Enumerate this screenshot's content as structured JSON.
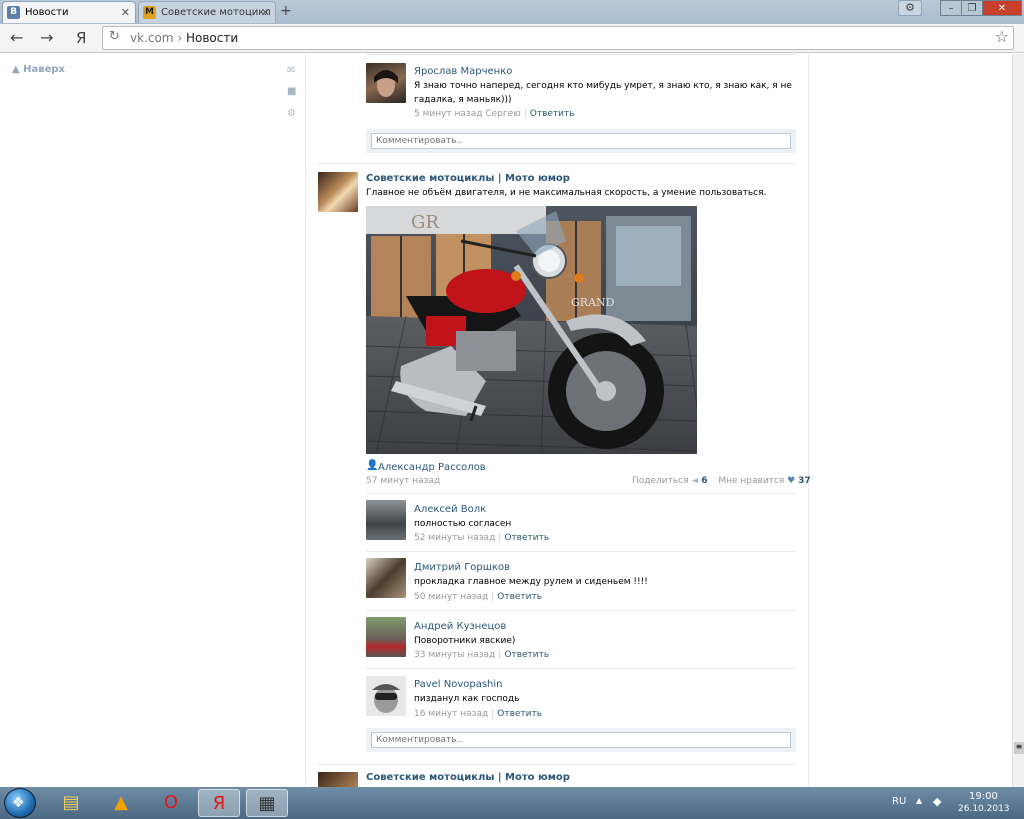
{
  "browser": {
    "tabs": [
      {
        "label": "Новости",
        "favicon": "В"
      },
      {
        "label": "Советские мотоцикл",
        "favicon": "M"
      }
    ],
    "newtab": "+",
    "yandex_btn": "Я",
    "url_domain": "vk.com",
    "url_sep": "›",
    "url_page": "Новости"
  },
  "sidebar": {
    "up_label": "▲ Наверх"
  },
  "top_comment": {
    "author": "Ярослав Марченко",
    "text": "Я знаю точно наперед, сегодня кто мибудь умрет, я знаю кто, я знаю как, я не гадалка, я маньяк)))",
    "time": "5 минут назад Сергею",
    "reply": "Ответить"
  },
  "comment_placeholder": "Комментировать..",
  "post": {
    "group": "Советские мотоциклы | Мото юмор",
    "text": "Главное не объём двигателя, и не максимальная скорость, а умение пользоваться.",
    "author": "Александр Рассолов",
    "time": "57 минут назад",
    "share_label": "Поделиться",
    "share_count": "6",
    "like_label": "Мне нравится",
    "like_count": "37",
    "image_sign_text": "GRAND",
    "image_sign_text2": "GR"
  },
  "comments": [
    {
      "author": "Алексей Волк",
      "text": "полностью согласен",
      "time": "52 минуты назад",
      "reply": "Ответить"
    },
    {
      "author": "Дмитрий Горшков",
      "text": "прокладка главное между рулем и сиденьем !!!!",
      "time": "50 минут назад",
      "reply": "Ответить"
    },
    {
      "author": "Андрей Кузнецов",
      "text": "Поворотники явские)",
      "time": "33 минуты назад",
      "reply": "Ответить"
    },
    {
      "author": "Pavel Novopashin",
      "text": "пизданул как господь",
      "time": "16 минут назад",
      "reply": "Ответить"
    }
  ],
  "next_post": {
    "group": "Советские мотоциклы | Мото юмор"
  },
  "taskbar": {
    "lang": "RU",
    "time": "19:00",
    "date": "26.10.2013"
  },
  "colors": {
    "vk_link": "#2b587a",
    "muted": "#999999",
    "like_heart": "#5b84b1"
  }
}
